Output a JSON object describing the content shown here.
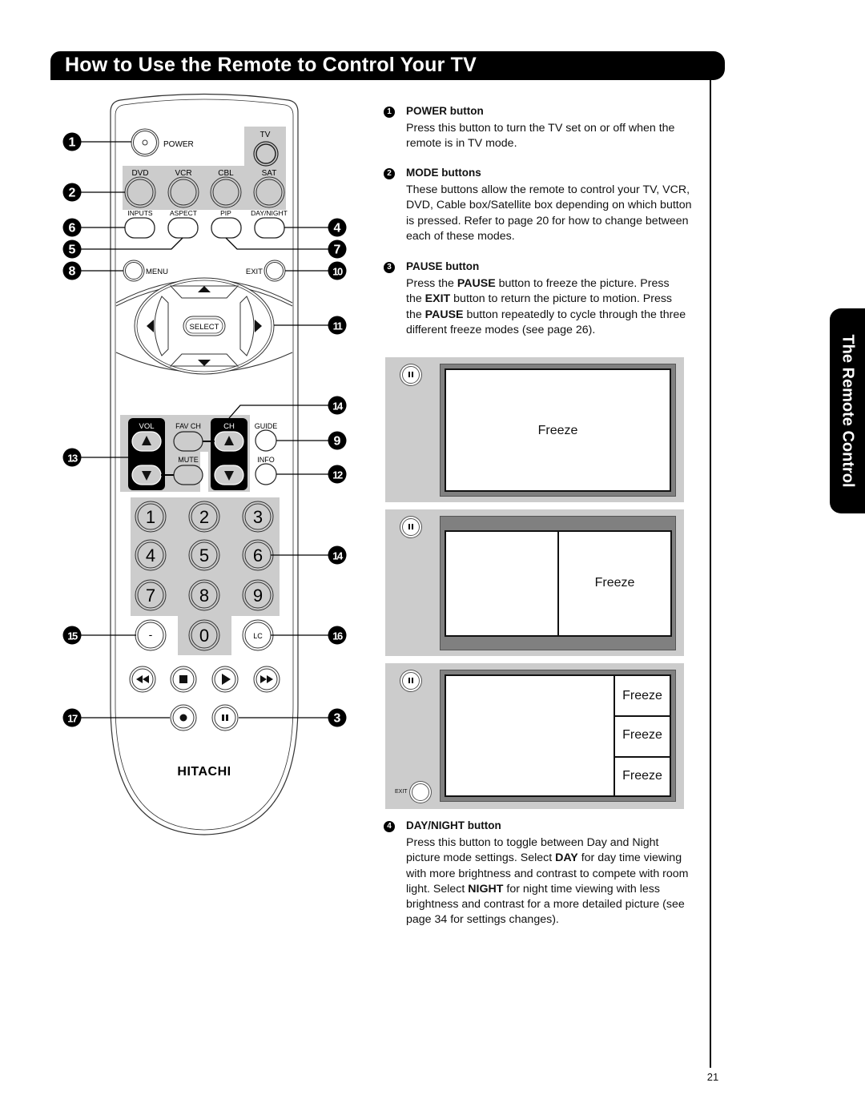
{
  "header": {
    "title": "How to Use the Remote to Control Your TV"
  },
  "side_tab": {
    "label": "The Remote Control"
  },
  "page_number": "21",
  "remote": {
    "brand": "HITACHI",
    "labels": {
      "power": "POWER",
      "tv": "TV",
      "dvd": "DVD",
      "vcr": "VCR",
      "cbl": "CBL",
      "sat": "SAT",
      "inputs": "INPUTS",
      "aspect": "ASPECT",
      "pip": "PIP",
      "day_night": "DAY/NIGHT",
      "menu": "MENU",
      "exit": "EXIT",
      "select": "SELECT",
      "vol": "VOL",
      "fav_ch": "FAV CH",
      "ch": "CH",
      "guide": "GUIDE",
      "mute": "MUTE",
      "info": "INFO",
      "dash": "-",
      "lc": "LC"
    },
    "number_keys": [
      "1",
      "2",
      "3",
      "4",
      "5",
      "6",
      "7",
      "8",
      "9",
      "0"
    ],
    "transport_icons": [
      "rewind-icon",
      "stop-icon",
      "play-icon",
      "fast-forward-icon",
      "record-icon",
      "pause-icon"
    ],
    "callouts": {
      "power": "1",
      "mode": "2",
      "inputs": "6",
      "day_night": "4",
      "aspect": "5",
      "pip": "7",
      "menu": "8",
      "exit": "10",
      "cursor": "11",
      "ch_top": "14",
      "guide": "9",
      "vol": "13",
      "info": "12",
      "numpad": "14",
      "dash": "15",
      "lc": "16",
      "record": "17",
      "pause": "3"
    }
  },
  "sections": [
    {
      "num": "1",
      "title": "POWER button",
      "body": [
        {
          "t": "Press this button to turn the TV set on or off when the remote is in TV mode."
        }
      ]
    },
    {
      "num": "2",
      "title": "MODE buttons",
      "body": [
        {
          "t": "These buttons allow the remote to control your TV, VCR, DVD, Cable box/Satellite box depending on which button is pressed.  Refer to page 20 for how to change between each of these modes."
        }
      ]
    },
    {
      "num": "3",
      "title": "PAUSE button",
      "body": [
        {
          "t": "Press the "
        },
        {
          "t": "PAUSE",
          "b": true
        },
        {
          "t": " button to freeze the picture. Press the "
        },
        {
          "t": "EXIT",
          "b": true
        },
        {
          "t": " button to return the picture to motion. Press the "
        },
        {
          "t": "PAUSE",
          "b": true
        },
        {
          "t": " button repeatedly to cycle through the three different freeze modes (see page 26)."
        }
      ]
    },
    {
      "num": "4",
      "title": "DAY/NIGHT button",
      "body": [
        {
          "t": "Press this button to toggle between Day and Night picture mode settings. Select "
        },
        {
          "t": "DAY",
          "b": true
        },
        {
          "t": " for day time viewing with more brightness and contrast to compete with room light. Select "
        },
        {
          "t": "NIGHT",
          "b": true
        },
        {
          "t": " for night time viewing with less brightness and contrast for a more detailed picture (see page 34 for settings changes)."
        }
      ]
    }
  ],
  "freeze_panels": {
    "label": "Freeze",
    "exit_label": "EXIT"
  }
}
